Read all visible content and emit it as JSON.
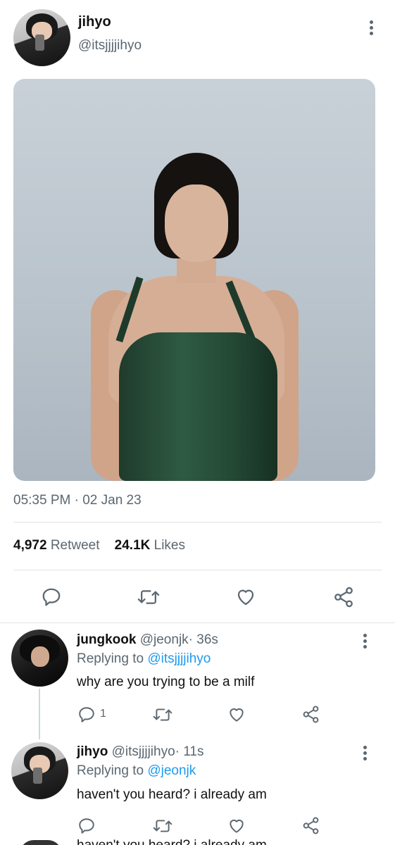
{
  "tweet": {
    "name": "jihyo",
    "handle": "@itsjjjjihyo",
    "timestamp": "05:35 PM · 02 Jan 23",
    "retweet_count": "4,972",
    "retweet_label": "Retweet",
    "like_count": "24.1K",
    "like_label": "Likes"
  },
  "replies": [
    {
      "name": "jungkook",
      "handle": "@jeonjk",
      "time": "· 36s",
      "replying_label": "Replying to",
      "replying_to": "@itsjjjjihyo",
      "text": "why are you trying to be a milf",
      "reply_count": "1"
    },
    {
      "name": "jihyo",
      "handle": "@itsjjjjihyo",
      "time": "· 11s",
      "replying_label": "Replying to",
      "replying_to": "@jeonjk",
      "text": "haven't you heard? i already am"
    }
  ],
  "cut_text": "haven't you heard? i already am",
  "colors": {
    "text": "#14171a",
    "secondary": "#5b6770",
    "link": "#1d9bf0",
    "divider": "#dfe3e6"
  }
}
